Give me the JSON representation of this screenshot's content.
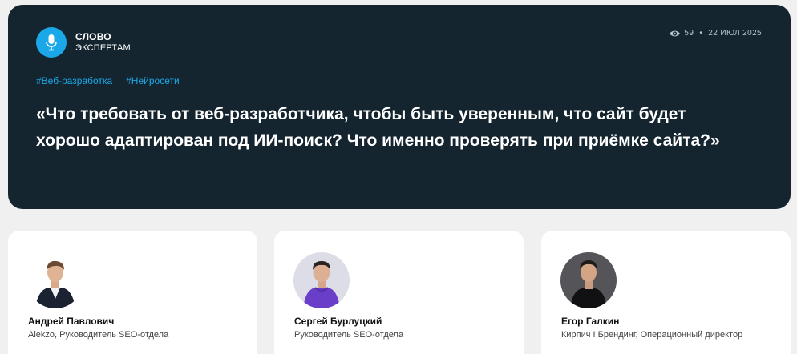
{
  "brand": {
    "line1": "СЛОВО",
    "line2": "ЭКСПЕРТАМ",
    "icon": "microphone-icon",
    "accent": "#1ba8e8"
  },
  "meta": {
    "views": "59",
    "separator": "•",
    "date": "22 ИЮЛ 2025"
  },
  "tags": [
    "#Веб-разработка",
    "#Нейросети"
  ],
  "question": "«Что требовать от веб-разработчика, чтобы быть уверенным, что сайт будет хорошо адаптирован под ИИ-поиск? Что именно проверять при приёмке сайта?»",
  "experts": [
    {
      "name": "Андрей Павлович",
      "role": "Alekzo, Руководитель SEO-отдела"
    },
    {
      "name": "Сергей Бурлуцкий",
      "role": "Руководитель SEO-отдела"
    },
    {
      "name": "Егор Галкин",
      "role": "Кирпич I Брендинг, Операционный директор"
    }
  ],
  "colors": {
    "hero_bg": "#14252f",
    "page_bg": "#f0f0f0",
    "card_bg": "#ffffff"
  }
}
